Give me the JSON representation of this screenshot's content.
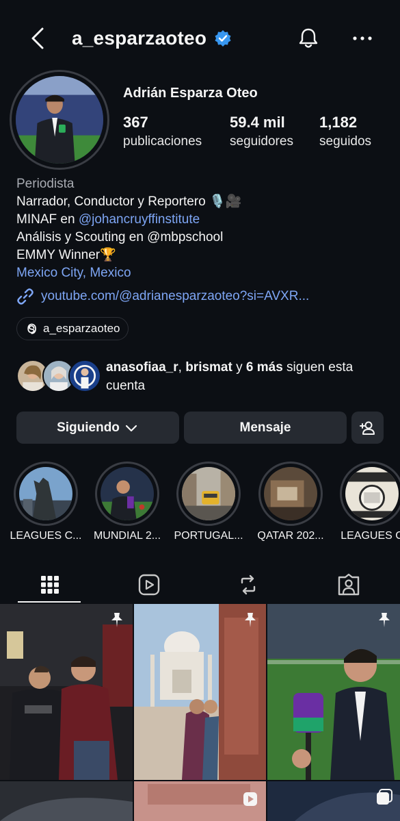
{
  "header": {
    "username": "a_esparzaoteo"
  },
  "profile": {
    "display_name": "Adrián Esparza Oteo",
    "stats": [
      {
        "value": "367",
        "label": "publicaciones"
      },
      {
        "value": "59.4 mil",
        "label": "seguidores"
      },
      {
        "value": "1,182",
        "label": "seguidos"
      }
    ],
    "bio": {
      "category": "Periodista",
      "line1": "Narrador, Conductor y Reportero",
      "line2_prefix": "MINAF en ",
      "line2_mention": "@johancruyffinstitute",
      "line3": "Análisis y Scouting en @mbpschool",
      "line4": "EMMY Winner",
      "location": "Mexico City, Mexico",
      "website": "youtube.com/@adrianesparzaoteo?si=AVXR..."
    },
    "threads_handle": "a_esparzaoteo"
  },
  "mutual": {
    "name1": "anasofiaa_r",
    "name2": "brismat",
    "connector": " y ",
    "more": "6 más",
    "suffix": " siguen esta cuenta"
  },
  "actions": {
    "following_label": "Siguiendo",
    "message_label": "Mensaje"
  },
  "highlights": [
    {
      "label": "LEAGUES C..."
    },
    {
      "label": "MUNDIAL 2..."
    },
    {
      "label": "PORTUGAL..."
    },
    {
      "label": "QATAR 202..."
    },
    {
      "label": "LEAGUES C"
    }
  ],
  "colors": {
    "background": "#0c0f14",
    "button": "#262a31",
    "link": "#7ea6f5",
    "verified": "#3897f0"
  }
}
